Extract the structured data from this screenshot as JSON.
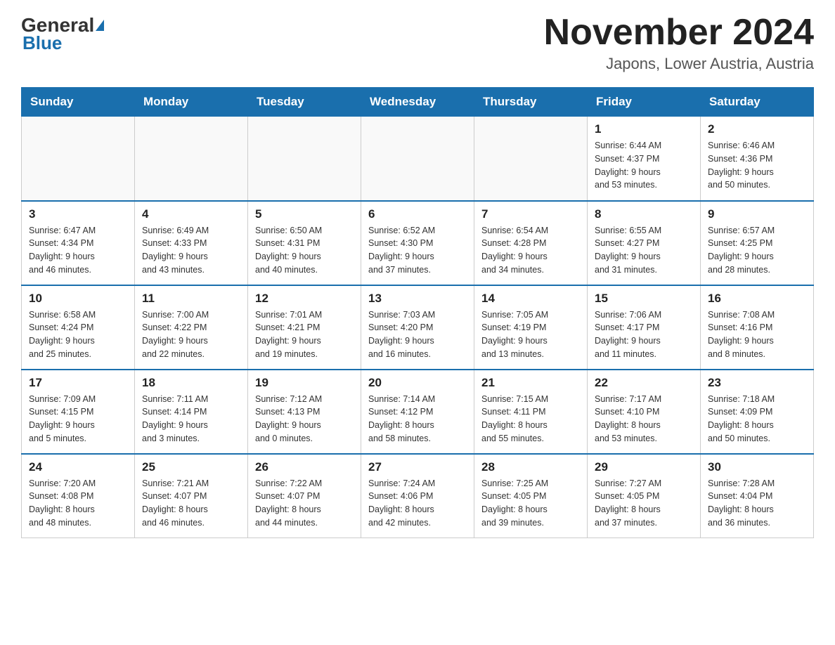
{
  "header": {
    "logo_general": "General",
    "logo_blue": "Blue",
    "month_year": "November 2024",
    "location": "Japons, Lower Austria, Austria"
  },
  "weekdays": [
    "Sunday",
    "Monday",
    "Tuesday",
    "Wednesday",
    "Thursday",
    "Friday",
    "Saturday"
  ],
  "weeks": [
    [
      {
        "day": "",
        "info": ""
      },
      {
        "day": "",
        "info": ""
      },
      {
        "day": "",
        "info": ""
      },
      {
        "day": "",
        "info": ""
      },
      {
        "day": "",
        "info": ""
      },
      {
        "day": "1",
        "info": "Sunrise: 6:44 AM\nSunset: 4:37 PM\nDaylight: 9 hours\nand 53 minutes."
      },
      {
        "day": "2",
        "info": "Sunrise: 6:46 AM\nSunset: 4:36 PM\nDaylight: 9 hours\nand 50 minutes."
      }
    ],
    [
      {
        "day": "3",
        "info": "Sunrise: 6:47 AM\nSunset: 4:34 PM\nDaylight: 9 hours\nand 46 minutes."
      },
      {
        "day": "4",
        "info": "Sunrise: 6:49 AM\nSunset: 4:33 PM\nDaylight: 9 hours\nand 43 minutes."
      },
      {
        "day": "5",
        "info": "Sunrise: 6:50 AM\nSunset: 4:31 PM\nDaylight: 9 hours\nand 40 minutes."
      },
      {
        "day": "6",
        "info": "Sunrise: 6:52 AM\nSunset: 4:30 PM\nDaylight: 9 hours\nand 37 minutes."
      },
      {
        "day": "7",
        "info": "Sunrise: 6:54 AM\nSunset: 4:28 PM\nDaylight: 9 hours\nand 34 minutes."
      },
      {
        "day": "8",
        "info": "Sunrise: 6:55 AM\nSunset: 4:27 PM\nDaylight: 9 hours\nand 31 minutes."
      },
      {
        "day": "9",
        "info": "Sunrise: 6:57 AM\nSunset: 4:25 PM\nDaylight: 9 hours\nand 28 minutes."
      }
    ],
    [
      {
        "day": "10",
        "info": "Sunrise: 6:58 AM\nSunset: 4:24 PM\nDaylight: 9 hours\nand 25 minutes."
      },
      {
        "day": "11",
        "info": "Sunrise: 7:00 AM\nSunset: 4:22 PM\nDaylight: 9 hours\nand 22 minutes."
      },
      {
        "day": "12",
        "info": "Sunrise: 7:01 AM\nSunset: 4:21 PM\nDaylight: 9 hours\nand 19 minutes."
      },
      {
        "day": "13",
        "info": "Sunrise: 7:03 AM\nSunset: 4:20 PM\nDaylight: 9 hours\nand 16 minutes."
      },
      {
        "day": "14",
        "info": "Sunrise: 7:05 AM\nSunset: 4:19 PM\nDaylight: 9 hours\nand 13 minutes."
      },
      {
        "day": "15",
        "info": "Sunrise: 7:06 AM\nSunset: 4:17 PM\nDaylight: 9 hours\nand 11 minutes."
      },
      {
        "day": "16",
        "info": "Sunrise: 7:08 AM\nSunset: 4:16 PM\nDaylight: 9 hours\nand 8 minutes."
      }
    ],
    [
      {
        "day": "17",
        "info": "Sunrise: 7:09 AM\nSunset: 4:15 PM\nDaylight: 9 hours\nand 5 minutes."
      },
      {
        "day": "18",
        "info": "Sunrise: 7:11 AM\nSunset: 4:14 PM\nDaylight: 9 hours\nand 3 minutes."
      },
      {
        "day": "19",
        "info": "Sunrise: 7:12 AM\nSunset: 4:13 PM\nDaylight: 9 hours\nand 0 minutes."
      },
      {
        "day": "20",
        "info": "Sunrise: 7:14 AM\nSunset: 4:12 PM\nDaylight: 8 hours\nand 58 minutes."
      },
      {
        "day": "21",
        "info": "Sunrise: 7:15 AM\nSunset: 4:11 PM\nDaylight: 8 hours\nand 55 minutes."
      },
      {
        "day": "22",
        "info": "Sunrise: 7:17 AM\nSunset: 4:10 PM\nDaylight: 8 hours\nand 53 minutes."
      },
      {
        "day": "23",
        "info": "Sunrise: 7:18 AM\nSunset: 4:09 PM\nDaylight: 8 hours\nand 50 minutes."
      }
    ],
    [
      {
        "day": "24",
        "info": "Sunrise: 7:20 AM\nSunset: 4:08 PM\nDaylight: 8 hours\nand 48 minutes."
      },
      {
        "day": "25",
        "info": "Sunrise: 7:21 AM\nSunset: 4:07 PM\nDaylight: 8 hours\nand 46 minutes."
      },
      {
        "day": "26",
        "info": "Sunrise: 7:22 AM\nSunset: 4:07 PM\nDaylight: 8 hours\nand 44 minutes."
      },
      {
        "day": "27",
        "info": "Sunrise: 7:24 AM\nSunset: 4:06 PM\nDaylight: 8 hours\nand 42 minutes."
      },
      {
        "day": "28",
        "info": "Sunrise: 7:25 AM\nSunset: 4:05 PM\nDaylight: 8 hours\nand 39 minutes."
      },
      {
        "day": "29",
        "info": "Sunrise: 7:27 AM\nSunset: 4:05 PM\nDaylight: 8 hours\nand 37 minutes."
      },
      {
        "day": "30",
        "info": "Sunrise: 7:28 AM\nSunset: 4:04 PM\nDaylight: 8 hours\nand 36 minutes."
      }
    ]
  ]
}
